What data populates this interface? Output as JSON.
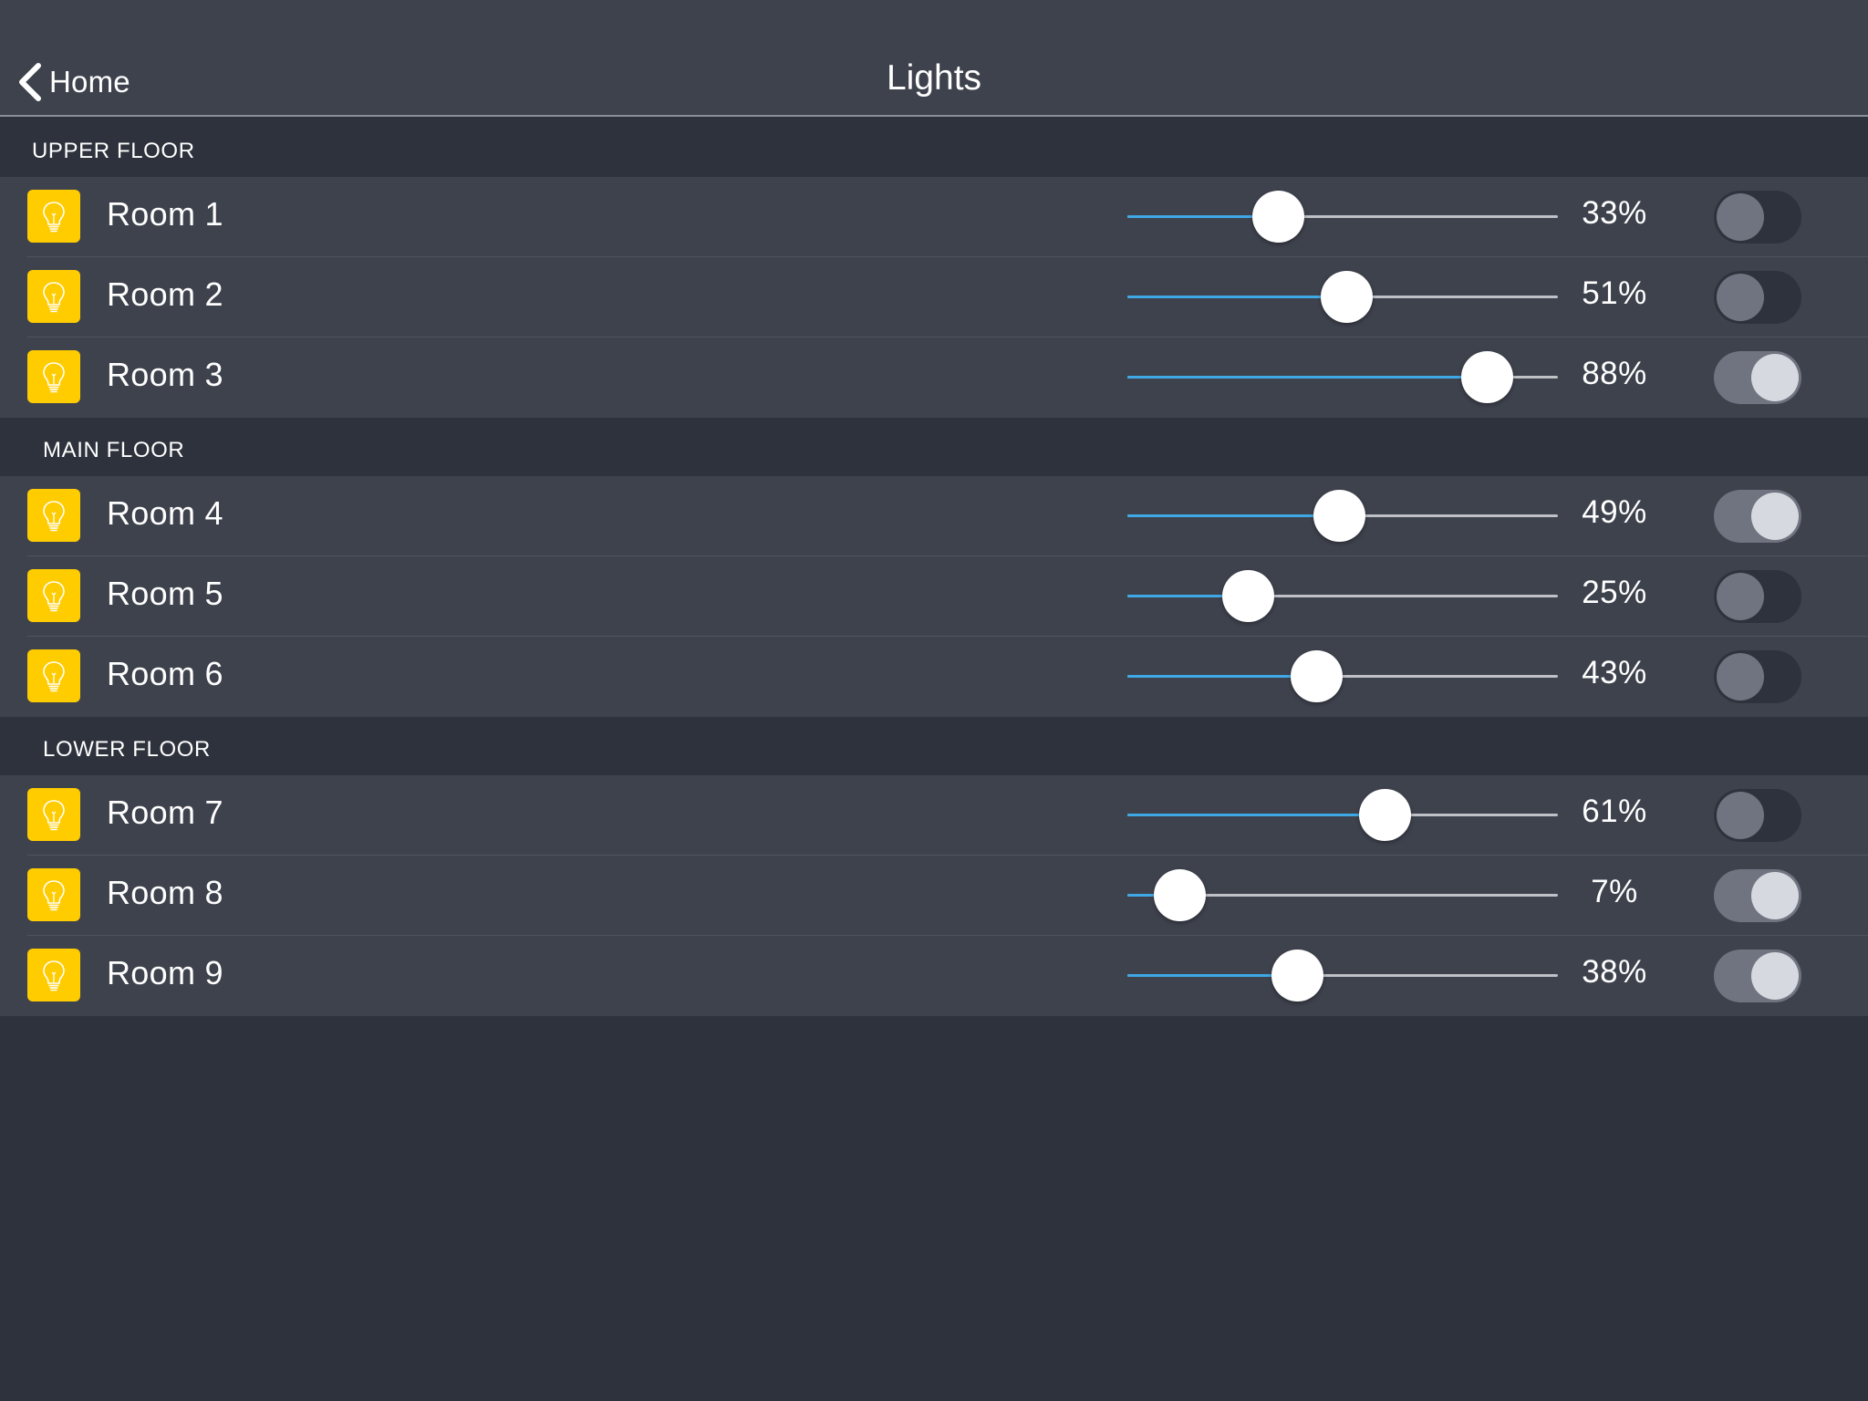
{
  "nav": {
    "back_label": "Home",
    "title": "Lights"
  },
  "sections": [
    {
      "label": "UPPER FLOOR",
      "rooms": [
        {
          "name": "Room 1",
          "brightness": 33,
          "percent_label": "33%",
          "on": false
        },
        {
          "name": "Room 2",
          "brightness": 51,
          "percent_label": "51%",
          "on": false
        },
        {
          "name": "Room 3",
          "brightness": 88,
          "percent_label": "88%",
          "on": true
        }
      ]
    },
    {
      "label": "MAIN FLOOR",
      "rooms": [
        {
          "name": "Room 4",
          "brightness": 49,
          "percent_label": "49%",
          "on": true
        },
        {
          "name": "Room 5",
          "brightness": 25,
          "percent_label": "25%",
          "on": false
        },
        {
          "name": "Room 6",
          "brightness": 43,
          "percent_label": "43%",
          "on": false
        }
      ]
    },
    {
      "label": "LOWER FLOOR",
      "rooms": [
        {
          "name": "Room 7",
          "brightness": 61,
          "percent_label": "61%",
          "on": false
        },
        {
          "name": "Room 8",
          "brightness": 7,
          "percent_label": "7%",
          "on": true
        },
        {
          "name": "Room 9",
          "brightness": 38,
          "percent_label": "38%",
          "on": true
        }
      ]
    }
  ],
  "icons": {
    "back": "chevron-left-icon",
    "room": "lightbulb-icon"
  },
  "colors": {
    "accent_blue": "#3fa9e6",
    "bulb_yellow": "#ffcc00",
    "row_background": "#3e424d",
    "page_background": "#2e323c"
  }
}
